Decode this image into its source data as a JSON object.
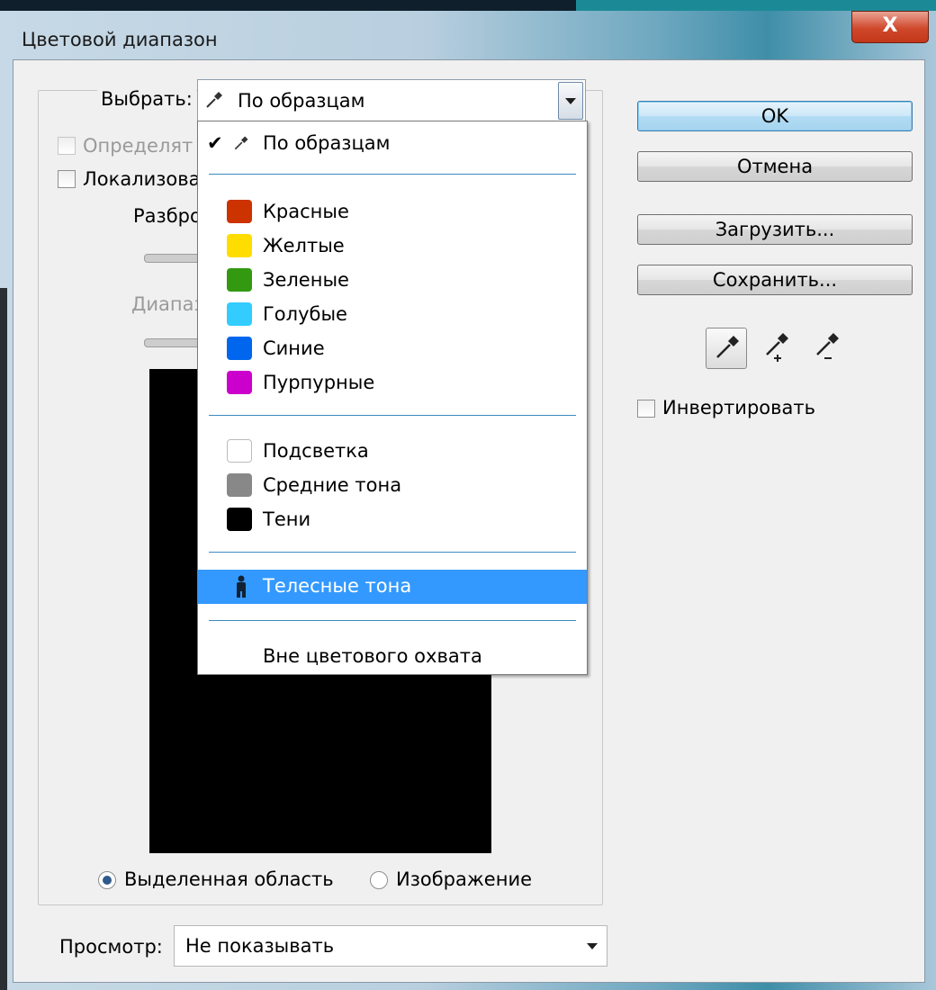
{
  "window": {
    "title": "Цветовой диапазон",
    "close_glyph": "X"
  },
  "select_row": {
    "label": "Выбрать:",
    "value": "По образцам",
    "icon": "eyedropper-icon"
  },
  "checkboxes": {
    "localized_label_partial": "Локализова",
    "detect_faces_label_partial": "Определят"
  },
  "fuzziness": {
    "label_partial": "Разбро"
  },
  "range": {
    "label_partial": "Диапаз"
  },
  "dropdown": {
    "checked_item": {
      "check": "✔",
      "label": "По образцам"
    },
    "color_items": [
      {
        "label": "Красные",
        "color": "#cc3300"
      },
      {
        "label": "Желтые",
        "color": "#ffdd00"
      },
      {
        "label": "Зеленые",
        "color": "#339911"
      },
      {
        "label": "Голубые",
        "color": "#33ccff"
      },
      {
        "label": "Синие",
        "color": "#0066ee"
      },
      {
        "label": "Пурпурные",
        "color": "#cc00cc"
      }
    ],
    "tone_items": [
      {
        "label": "Подсветка",
        "color": "#ffffff"
      },
      {
        "label": "Средние тона",
        "color": "#888888"
      },
      {
        "label": "Тени",
        "color": "#000000"
      }
    ],
    "skin_item": {
      "label": "Телесные тона",
      "icon": "person-icon",
      "highlighted": true
    },
    "gamut_item": {
      "label": "Вне цветового охвата"
    }
  },
  "view_mode": {
    "selection_label": "Выделенная область",
    "image_label": "Изображение",
    "selected": "selection"
  },
  "preview_select": {
    "label": "Просмотр:",
    "value": "Не показывать"
  },
  "buttons": {
    "ok": "OK",
    "cancel": "Отмена",
    "load": "Загрузить...",
    "save": "Сохранить..."
  },
  "tools": [
    "eyedropper-icon",
    "eyedropper-plus-icon",
    "eyedropper-minus-icon"
  ],
  "invert": {
    "label": "Инвертировать",
    "checked": false
  },
  "colors": {
    "highlight": "#3399ff",
    "separator": "#3a8bbf"
  }
}
